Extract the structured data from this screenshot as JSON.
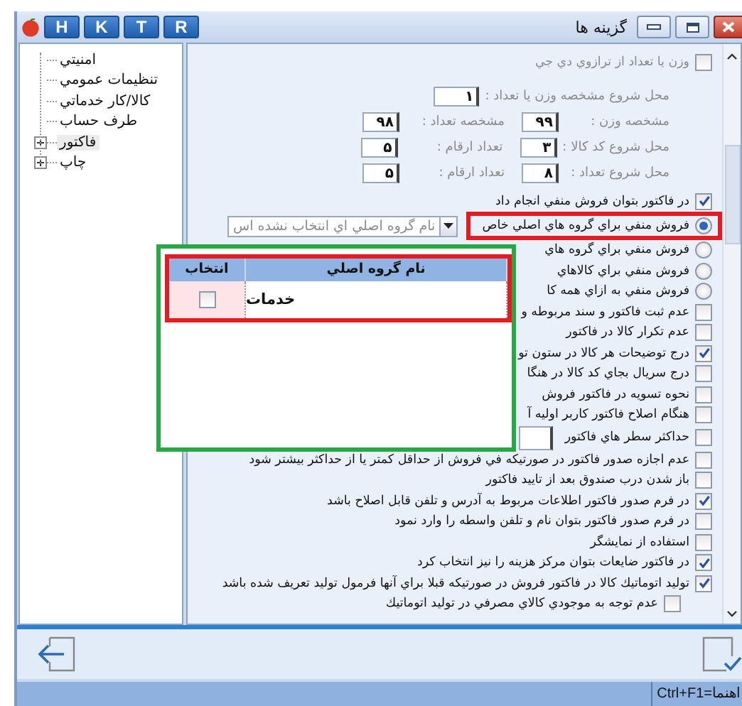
{
  "window": {
    "title": "گزينه ها",
    "shortcut_buttons": [
      "R",
      "T",
      "K",
      "H"
    ]
  },
  "tree": [
    {
      "kind": "leaf",
      "label": "امنيتي",
      "selected": false
    },
    {
      "kind": "leaf",
      "label": "تنظيمات عمومي",
      "selected": false
    },
    {
      "kind": "leaf",
      "label": "كالا/كار خدماتي",
      "selected": false
    },
    {
      "kind": "leaf",
      "label": "طرف حساب",
      "selected": false
    },
    {
      "kind": "folder",
      "label": "فاكتور",
      "selected": true,
      "expanded": false
    },
    {
      "kind": "folder",
      "label": "چاپ",
      "selected": false,
      "expanded": false
    }
  ],
  "options": {
    "scale": {
      "label": "وزن يا تعداد از ترازوي دي جي",
      "checked": false,
      "disabled": true
    },
    "field_rows": [
      [
        {
          "label": "محل شروع مشخصه وزن يا تعداد :",
          "value": "۱",
          "disabled": true
        }
      ],
      [
        {
          "label": "مشخصه وزن :",
          "value": "۹۹",
          "disabled": true
        },
        {
          "label": "مشخصه تعداد :",
          "value": "۹۸",
          "disabled": true
        }
      ],
      [
        {
          "label": "محل شروع كد كالا :",
          "value": "۳",
          "disabled": true
        },
        {
          "label": "تعداد  ارقام :",
          "value": "۵",
          "disabled": true
        }
      ],
      [
        {
          "label": "محل شروع تعداد :",
          "value": "۸",
          "disabled": true
        },
        {
          "label": "تعداد  ارقام :",
          "value": "۵",
          "disabled": true
        }
      ]
    ],
    "items": [
      {
        "kind": "checkbox",
        "label": "در فاكتور بتوان فروش منفي انجام داد",
        "checked": true
      },
      {
        "kind": "radio",
        "label": "فروش منفي براي گروه هاي اصلي خاص",
        "selected": true,
        "highlighted": true,
        "combo": {
          "value": "نام گروه اصلي اي انتخاب نشده اس"
        }
      },
      {
        "kind": "radio",
        "label": "فروش منفي براي گروه هاي",
        "selected": false
      },
      {
        "kind": "radio",
        "label": "فروش منفي براي كالاهاي",
        "selected": false
      },
      {
        "kind": "radio",
        "label": "فروش منفي به ازاي همه كا",
        "selected": false
      },
      {
        "kind": "checkbox",
        "label": "عدم ثبت فاكتور و سند مربوطه و",
        "checked": false
      },
      {
        "kind": "checkbox",
        "label": "عدم تكرار كالا در فاكتور",
        "checked": false
      },
      {
        "kind": "checkbox",
        "label": "درج توضيحات هر كالا در ستون تو",
        "checked": true
      },
      {
        "kind": "checkbox",
        "label": "درج سريال بجاي كد كالا در هنگا",
        "checked": false
      },
      {
        "kind": "checkbox",
        "label": "نحوه تسويه در فاكتور فروش",
        "checked": false
      },
      {
        "kind": "checkbox",
        "label": "هنگام اصلاح فاكتور كاربر اوليه آ",
        "checked": false
      },
      {
        "kind": "checkbox-field",
        "label": "حداكثر سطر هاي فاكتور",
        "checked": false
      },
      {
        "kind": "checkbox",
        "label": "عدم اجازه صدور فاكتور در صورتيكه في فروش از حداقل كمتر يا از حداكثر بيشتر شود",
        "checked": false
      },
      {
        "kind": "checkbox",
        "label": "باز شدن درب صندوق بعد از تاييد فاكتور",
        "checked": false
      },
      {
        "kind": "checkbox",
        "label": "در فرم صدور فاكتور اطلاعات مربوط به آدرس و تلفن قابل اصلاح باشد",
        "checked": true
      },
      {
        "kind": "checkbox",
        "label": "در فرم صدور فاكتور بتوان نام و تلفن واسطه را وارد نمود",
        "checked": false
      },
      {
        "kind": "checkbox",
        "label": "استفاده از نمايشگر",
        "checked": false
      },
      {
        "kind": "checkbox",
        "label": "در فاكتور ضايعات بتوان مركز هزينه را نيز انتخاب كرد",
        "checked": true
      },
      {
        "kind": "checkbox",
        "label": "توليد اتوماتيك كالا در فاكتور فروش در صورتيكه قبلا براي آنها فرمول توليد تعريف شده باشد",
        "checked": true,
        "children": [
          {
            "kind": "checkbox",
            "label": "عدم توجه به موجودي كالاي مصرفي در توليد اتوماتيك",
            "checked": false
          }
        ]
      }
    ]
  },
  "popup": {
    "highlighted": true,
    "table": {
      "highlighted": true,
      "columns": [
        "نام گروه اصلي",
        "انتخاب"
      ],
      "rows": [
        {
          "name": "خدمات",
          "checked": false
        }
      ]
    }
  },
  "status_bar": {
    "text": "Ctrl+F1=اهنما"
  }
}
